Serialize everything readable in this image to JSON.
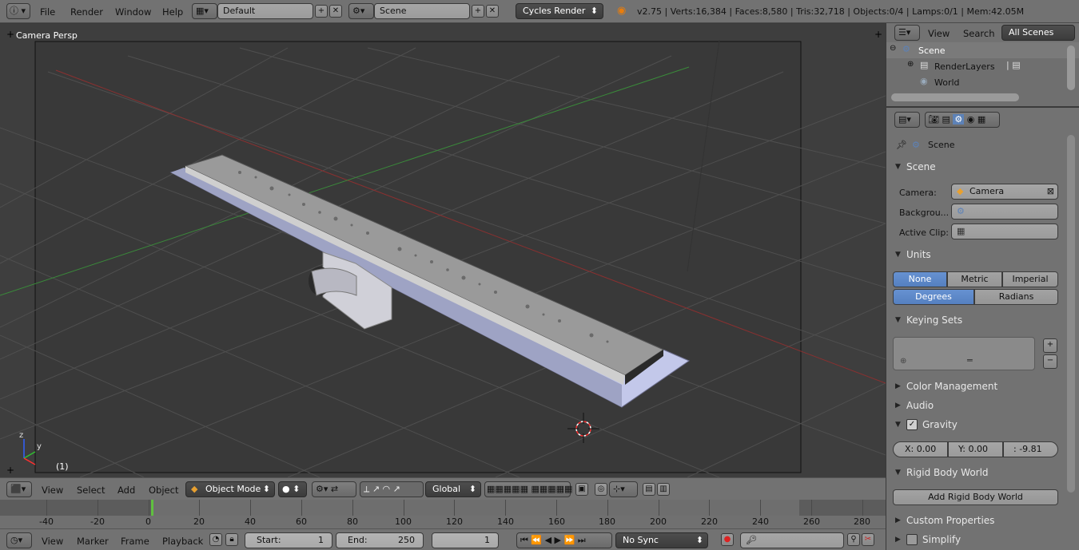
{
  "topbar": {
    "menus": [
      "File",
      "Render",
      "Window",
      "Help"
    ],
    "layout": "Default",
    "scene": "Scene",
    "engine": "Cycles Render",
    "stats": "v2.75 | Verts:16,384 | Faces:8,580 | Tris:32,718 | Objects:0/4 | Lamps:0/1 | Mem:42.05M"
  },
  "viewport": {
    "label": "Camera Persp",
    "frame": "(1)",
    "axis_y": "y",
    "axis_z": "z"
  },
  "viewport_header": {
    "menus": [
      "View",
      "Select",
      "Add",
      "Object"
    ],
    "mode": "Object Mode",
    "orientation": "Global"
  },
  "outliner": {
    "menus": [
      "View",
      "Search"
    ],
    "filter": "All Scenes",
    "items": [
      "Scene",
      "RenderLayers",
      "World"
    ]
  },
  "properties": {
    "context": "Scene",
    "scene_panel": {
      "title": "Scene",
      "camera_label": "Camera:",
      "camera_value": "Camera",
      "background_label": "Backgrou...",
      "clip_label": "Active Clip:"
    },
    "units_panel": {
      "title": "Units",
      "systems": [
        "None",
        "Metric",
        "Imperial"
      ],
      "rotation": [
        "Degrees",
        "Radians"
      ]
    },
    "keying_panel": {
      "title": "Keying Sets"
    },
    "color_panel": {
      "title": "Color Management"
    },
    "audio_panel": {
      "title": "Audio"
    },
    "gravity_panel": {
      "title": "Gravity",
      "x": "X: 0.00",
      "y": "Y:  0.00",
      "z": ":    -9.81"
    },
    "rigid_panel": {
      "title": "Rigid Body World",
      "button": "Add Rigid Body World"
    },
    "custom_panel": {
      "title": "Custom Properties"
    },
    "simplify_panel": {
      "title": "Simplify"
    }
  },
  "timeline": {
    "ticks": [
      "-40",
      "-20",
      "0",
      "20",
      "40",
      "60",
      "80",
      "100",
      "120",
      "140",
      "160",
      "180",
      "200",
      "220",
      "240",
      "260",
      "280"
    ],
    "menus": [
      "View",
      "Marker",
      "Frame",
      "Playback"
    ],
    "start": "Start:",
    "start_val": "1",
    "end": "End:",
    "end_val": "250",
    "current": "1",
    "sync": "No Sync"
  }
}
